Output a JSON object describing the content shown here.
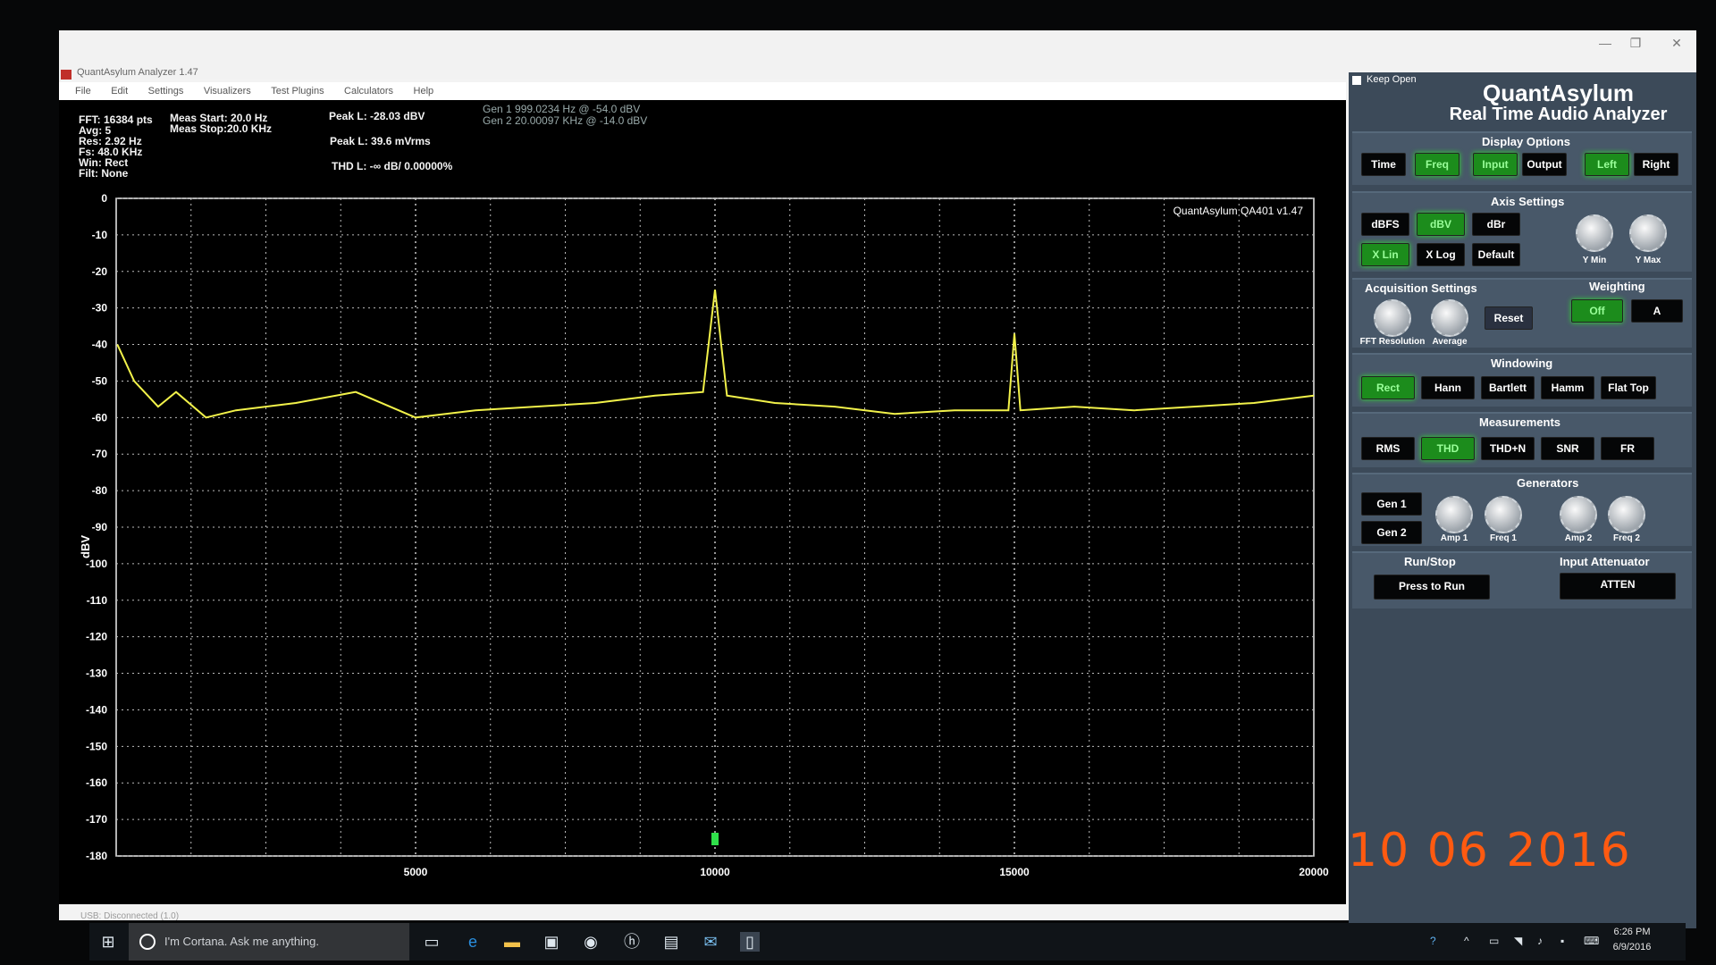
{
  "window": {
    "title": "QuantAsylum Analyzer 1.47",
    "controls": [
      "—",
      "❐",
      "✕"
    ]
  },
  "menu": [
    "File",
    "Edit",
    "Settings",
    "Visualizers",
    "Test Plugins",
    "Calculators",
    "Help"
  ],
  "stats": {
    "fft": "FFT: 16384 pts",
    "avg": "Avg: 5",
    "res": "Res: 2.92 Hz",
    "fs": "Fs: 48.0 KHz",
    "win": "Win: Rect",
    "filt": "Filt: None",
    "meas_start": "Meas Start: 20.0 Hz",
    "meas_stop": "Meas Stop:20.0 KHz",
    "peak_dbv": "Peak L: -28.03 dBV",
    "peak_mv": "Peak L: 39.6 mVrms",
    "thd": "THD L: -∞ dB/ 0.00000%",
    "gen1": "Gen 1  999.0234 Hz @ -54.0  dBV",
    "gen2": "Gen 2 20.00097 KHz @ -14.0  dBV"
  },
  "chart_data": {
    "type": "line",
    "title": "QuantAsylum QA401 v1.47",
    "xlabel": "",
    "ylabel": "dBV",
    "xlim": [
      0,
      20000
    ],
    "ylim": [
      -180,
      0
    ],
    "x_ticks": [
      "5000",
      "10000",
      "15000",
      "20000"
    ],
    "y_ticks": [
      "0",
      "-10",
      "-20",
      "-30",
      "-40",
      "-50",
      "-60",
      "-70",
      "-80",
      "-90",
      "-100",
      "-110",
      "-120",
      "-130",
      "-140",
      "-150",
      "-160",
      "-170",
      "-180"
    ],
    "grid": true,
    "line_color": "#f2f24a",
    "series": [
      {
        "x": [
          20,
          300,
          700,
          1000,
          1500,
          2000,
          3000,
          4000,
          5000,
          6000,
          7000,
          8000,
          9000,
          9800,
          10000,
          10200,
          11000,
          12000,
          13000,
          14000,
          14900,
          15000,
          15100,
          16000,
          17000,
          18000,
          19000,
          20000
        ],
        "values": [
          -40,
          -50,
          -57,
          -53,
          -60,
          -58,
          -56,
          -53,
          -60,
          -58,
          -57,
          -56,
          -54,
          -53,
          -25,
          -54,
          -56,
          -57,
          -59,
          -58,
          -58,
          -37,
          -58,
          -57,
          -58,
          -57,
          -56,
          -54
        ]
      }
    ],
    "marker_x": 10000
  },
  "panel": {
    "keep_open": "Keep Open",
    "brand": "QuantAsylum",
    "subtitle": "Real Time Audio Analyzer",
    "display_options": "Display Options",
    "display_buttons": [
      "Time",
      "Freq",
      "Input",
      "Output",
      "Left",
      "Right"
    ],
    "axis_settings": "Axis Settings",
    "axis_buttons": [
      "dBFS",
      "dBV",
      "dBr",
      "X Lin",
      "X Log",
      "Default"
    ],
    "ymin": "Y Min",
    "ymax": "Y Max",
    "acq_settings": "Acquisition Settings",
    "fft_res": "FFT Resolution",
    "average": "Average",
    "reset": "Reset",
    "weighting": "Weighting",
    "weighting_buttons": [
      "Off",
      "A"
    ],
    "windowing": "Windowing",
    "window_buttons": [
      "Rect",
      "Hann",
      "Bartlett",
      "Hamm",
      "Flat Top"
    ],
    "measurements": "Measurements",
    "meas_buttons": [
      "RMS",
      "THD",
      "THD+N",
      "SNR",
      "FR"
    ],
    "generators": "Generators",
    "gen_buttons": [
      "Gen 1",
      "Gen 2"
    ],
    "gen_knobs": [
      "Amp 1",
      "Freq 1",
      "Amp 2",
      "Freq 2"
    ],
    "run_stop": "Run/Stop",
    "press_to_run": "Press to Run",
    "input_atten": "Input Attenuator",
    "atten": "ATTEN"
  },
  "status_bar": "USB: Disconnected   (1.0)",
  "date_overlay": "10  06  2016",
  "taskbar": {
    "cortana": "I'm Cortana. Ask me anything.",
    "time": "6:26 PM",
    "date": "6/9/2016"
  }
}
